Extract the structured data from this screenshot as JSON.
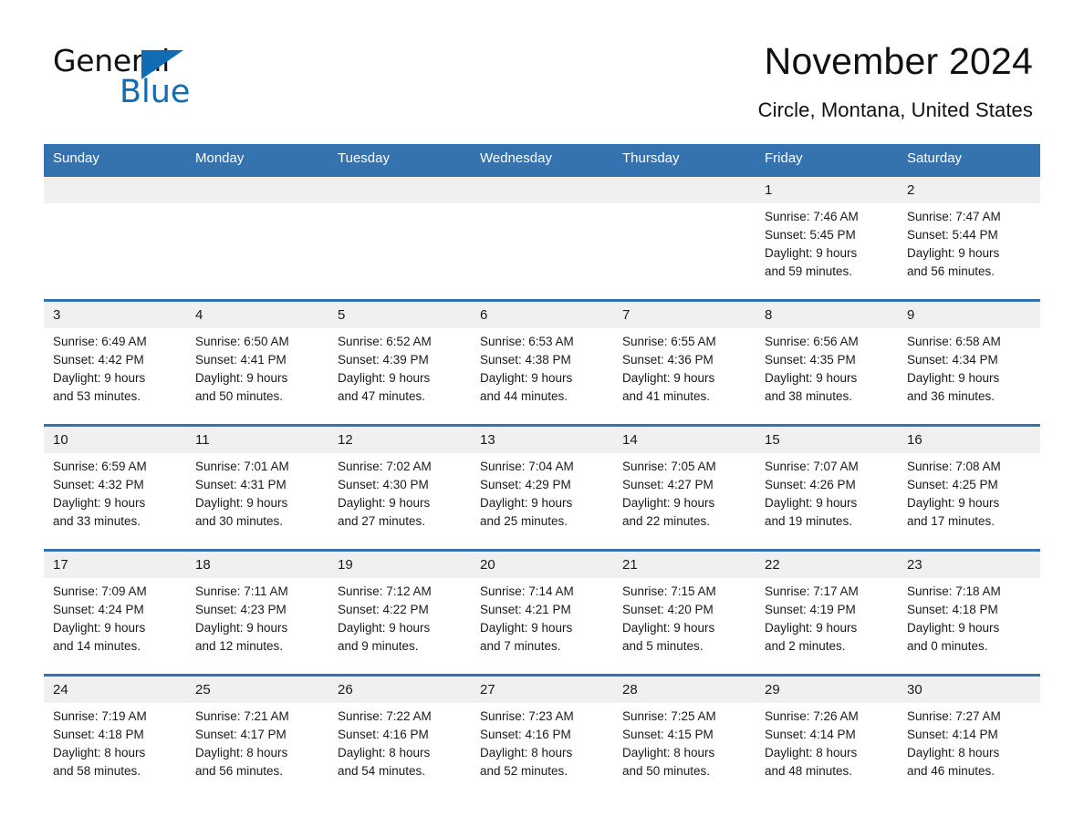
{
  "brand": {
    "name_part1": "General",
    "name_part2": "Blue",
    "triangle_color": "#0f6cb5"
  },
  "header": {
    "month_title": "November 2024",
    "location": "Circle, Montana, United States",
    "header_bg": "#3572b0"
  },
  "weekday_headers": [
    "Sunday",
    "Monday",
    "Tuesday",
    "Wednesday",
    "Thursday",
    "Friday",
    "Saturday"
  ],
  "weeks": [
    [
      {
        "day": "",
        "sunrise": "",
        "sunset": "",
        "daylight_line1": "",
        "daylight_line2": ""
      },
      {
        "day": "",
        "sunrise": "",
        "sunset": "",
        "daylight_line1": "",
        "daylight_line2": ""
      },
      {
        "day": "",
        "sunrise": "",
        "sunset": "",
        "daylight_line1": "",
        "daylight_line2": ""
      },
      {
        "day": "",
        "sunrise": "",
        "sunset": "",
        "daylight_line1": "",
        "daylight_line2": ""
      },
      {
        "day": "",
        "sunrise": "",
        "sunset": "",
        "daylight_line1": "",
        "daylight_line2": ""
      },
      {
        "day": "1",
        "sunrise": "Sunrise: 7:46 AM",
        "sunset": "Sunset: 5:45 PM",
        "daylight_line1": "Daylight: 9 hours",
        "daylight_line2": "and 59 minutes."
      },
      {
        "day": "2",
        "sunrise": "Sunrise: 7:47 AM",
        "sunset": "Sunset: 5:44 PM",
        "daylight_line1": "Daylight: 9 hours",
        "daylight_line2": "and 56 minutes."
      }
    ],
    [
      {
        "day": "3",
        "sunrise": "Sunrise: 6:49 AM",
        "sunset": "Sunset: 4:42 PM",
        "daylight_line1": "Daylight: 9 hours",
        "daylight_line2": "and 53 minutes."
      },
      {
        "day": "4",
        "sunrise": "Sunrise: 6:50 AM",
        "sunset": "Sunset: 4:41 PM",
        "daylight_line1": "Daylight: 9 hours",
        "daylight_line2": "and 50 minutes."
      },
      {
        "day": "5",
        "sunrise": "Sunrise: 6:52 AM",
        "sunset": "Sunset: 4:39 PM",
        "daylight_line1": "Daylight: 9 hours",
        "daylight_line2": "and 47 minutes."
      },
      {
        "day": "6",
        "sunrise": "Sunrise: 6:53 AM",
        "sunset": "Sunset: 4:38 PM",
        "daylight_line1": "Daylight: 9 hours",
        "daylight_line2": "and 44 minutes."
      },
      {
        "day": "7",
        "sunrise": "Sunrise: 6:55 AM",
        "sunset": "Sunset: 4:36 PM",
        "daylight_line1": "Daylight: 9 hours",
        "daylight_line2": "and 41 minutes."
      },
      {
        "day": "8",
        "sunrise": "Sunrise: 6:56 AM",
        "sunset": "Sunset: 4:35 PM",
        "daylight_line1": "Daylight: 9 hours",
        "daylight_line2": "and 38 minutes."
      },
      {
        "day": "9",
        "sunrise": "Sunrise: 6:58 AM",
        "sunset": "Sunset: 4:34 PM",
        "daylight_line1": "Daylight: 9 hours",
        "daylight_line2": "and 36 minutes."
      }
    ],
    [
      {
        "day": "10",
        "sunrise": "Sunrise: 6:59 AM",
        "sunset": "Sunset: 4:32 PM",
        "daylight_line1": "Daylight: 9 hours",
        "daylight_line2": "and 33 minutes."
      },
      {
        "day": "11",
        "sunrise": "Sunrise: 7:01 AM",
        "sunset": "Sunset: 4:31 PM",
        "daylight_line1": "Daylight: 9 hours",
        "daylight_line2": "and 30 minutes."
      },
      {
        "day": "12",
        "sunrise": "Sunrise: 7:02 AM",
        "sunset": "Sunset: 4:30 PM",
        "daylight_line1": "Daylight: 9 hours",
        "daylight_line2": "and 27 minutes."
      },
      {
        "day": "13",
        "sunrise": "Sunrise: 7:04 AM",
        "sunset": "Sunset: 4:29 PM",
        "daylight_line1": "Daylight: 9 hours",
        "daylight_line2": "and 25 minutes."
      },
      {
        "day": "14",
        "sunrise": "Sunrise: 7:05 AM",
        "sunset": "Sunset: 4:27 PM",
        "daylight_line1": "Daylight: 9 hours",
        "daylight_line2": "and 22 minutes."
      },
      {
        "day": "15",
        "sunrise": "Sunrise: 7:07 AM",
        "sunset": "Sunset: 4:26 PM",
        "daylight_line1": "Daylight: 9 hours",
        "daylight_line2": "and 19 minutes."
      },
      {
        "day": "16",
        "sunrise": "Sunrise: 7:08 AM",
        "sunset": "Sunset: 4:25 PM",
        "daylight_line1": "Daylight: 9 hours",
        "daylight_line2": "and 17 minutes."
      }
    ],
    [
      {
        "day": "17",
        "sunrise": "Sunrise: 7:09 AM",
        "sunset": "Sunset: 4:24 PM",
        "daylight_line1": "Daylight: 9 hours",
        "daylight_line2": "and 14 minutes."
      },
      {
        "day": "18",
        "sunrise": "Sunrise: 7:11 AM",
        "sunset": "Sunset: 4:23 PM",
        "daylight_line1": "Daylight: 9 hours",
        "daylight_line2": "and 12 minutes."
      },
      {
        "day": "19",
        "sunrise": "Sunrise: 7:12 AM",
        "sunset": "Sunset: 4:22 PM",
        "daylight_line1": "Daylight: 9 hours",
        "daylight_line2": "and 9 minutes."
      },
      {
        "day": "20",
        "sunrise": "Sunrise: 7:14 AM",
        "sunset": "Sunset: 4:21 PM",
        "daylight_line1": "Daylight: 9 hours",
        "daylight_line2": "and 7 minutes."
      },
      {
        "day": "21",
        "sunrise": "Sunrise: 7:15 AM",
        "sunset": "Sunset: 4:20 PM",
        "daylight_line1": "Daylight: 9 hours",
        "daylight_line2": "and 5 minutes."
      },
      {
        "day": "22",
        "sunrise": "Sunrise: 7:17 AM",
        "sunset": "Sunset: 4:19 PM",
        "daylight_line1": "Daylight: 9 hours",
        "daylight_line2": "and 2 minutes."
      },
      {
        "day": "23",
        "sunrise": "Sunrise: 7:18 AM",
        "sunset": "Sunset: 4:18 PM",
        "daylight_line1": "Daylight: 9 hours",
        "daylight_line2": "and 0 minutes."
      }
    ],
    [
      {
        "day": "24",
        "sunrise": "Sunrise: 7:19 AM",
        "sunset": "Sunset: 4:18 PM",
        "daylight_line1": "Daylight: 8 hours",
        "daylight_line2": "and 58 minutes."
      },
      {
        "day": "25",
        "sunrise": "Sunrise: 7:21 AM",
        "sunset": "Sunset: 4:17 PM",
        "daylight_line1": "Daylight: 8 hours",
        "daylight_line2": "and 56 minutes."
      },
      {
        "day": "26",
        "sunrise": "Sunrise: 7:22 AM",
        "sunset": "Sunset: 4:16 PM",
        "daylight_line1": "Daylight: 8 hours",
        "daylight_line2": "and 54 minutes."
      },
      {
        "day": "27",
        "sunrise": "Sunrise: 7:23 AM",
        "sunset": "Sunset: 4:16 PM",
        "daylight_line1": "Daylight: 8 hours",
        "daylight_line2": "and 52 minutes."
      },
      {
        "day": "28",
        "sunrise": "Sunrise: 7:25 AM",
        "sunset": "Sunset: 4:15 PM",
        "daylight_line1": "Daylight: 8 hours",
        "daylight_line2": "and 50 minutes."
      },
      {
        "day": "29",
        "sunrise": "Sunrise: 7:26 AM",
        "sunset": "Sunset: 4:14 PM",
        "daylight_line1": "Daylight: 8 hours",
        "daylight_line2": "and 48 minutes."
      },
      {
        "day": "30",
        "sunrise": "Sunrise: 7:27 AM",
        "sunset": "Sunset: 4:14 PM",
        "daylight_line1": "Daylight: 8 hours",
        "daylight_line2": "and 46 minutes."
      }
    ]
  ]
}
